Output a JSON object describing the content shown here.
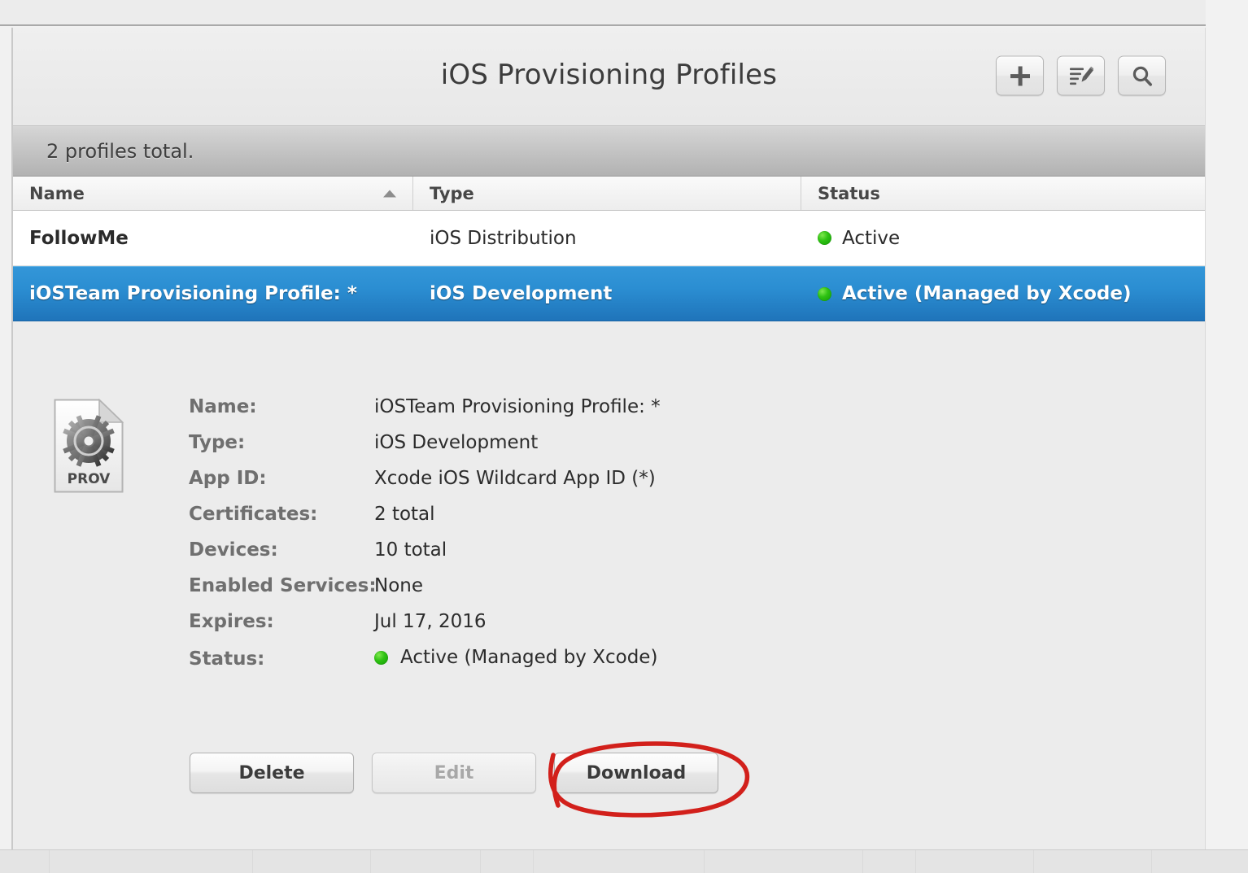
{
  "header": {
    "title": "iOS Provisioning Profiles",
    "buttons": [
      {
        "name": "add-button",
        "icon": "plus-icon",
        "label": "+"
      },
      {
        "name": "edit-list-button",
        "icon": "edit-pencil-icon",
        "label": "Edit"
      },
      {
        "name": "search-button",
        "icon": "search-icon",
        "label": "Search"
      }
    ]
  },
  "summary": {
    "text": "2 profiles total."
  },
  "table": {
    "columns": [
      {
        "key": "name",
        "label": "Name",
        "sorted": "ascending"
      },
      {
        "key": "type",
        "label": "Type",
        "sorted": "none"
      },
      {
        "key": "status",
        "label": "Status",
        "sorted": "none"
      }
    ],
    "rows": [
      {
        "name": "FollowMe",
        "type": "iOS Distribution",
        "status": "Active",
        "status_color": "#22b80b",
        "selected": false
      },
      {
        "name": "iOSTeam Provisioning Profile: *",
        "type": "iOS Development",
        "status": "Active (Managed by Xcode)",
        "status_color": "#22b80b",
        "selected": true
      }
    ]
  },
  "detail": {
    "icon_label": "PROV",
    "icon_name": "provisioning-profile-file-icon",
    "fields": [
      {
        "label": "Name:",
        "value": "iOSTeam Provisioning Profile: *"
      },
      {
        "label": "Type:",
        "value": "iOS Development"
      },
      {
        "label": "App ID:",
        "value": "Xcode iOS Wildcard App ID (*)"
      },
      {
        "label": "Certificates:",
        "value": "2 total"
      },
      {
        "label": "Devices:",
        "value": "10 total"
      },
      {
        "label": "Enabled Services:",
        "value": "None"
      },
      {
        "label": "Expires:",
        "value": "Jul 17, 2016"
      },
      {
        "label": "Status:",
        "value": "Active (Managed by Xcode)",
        "has_dot": true
      }
    ],
    "actions": [
      {
        "name": "delete-button",
        "label": "Delete",
        "disabled": false
      },
      {
        "name": "edit-button",
        "label": "Edit",
        "disabled": true
      },
      {
        "name": "download-button",
        "label": "Download",
        "disabled": false
      }
    ]
  },
  "annotation": {
    "shape": "hand-drawn-ellipse",
    "color": "#d2201b",
    "target": "download-button"
  },
  "colors": {
    "selection_blue": "#2b8ed2",
    "status_green": "#22b80b",
    "annotation_red": "#d2201b"
  }
}
